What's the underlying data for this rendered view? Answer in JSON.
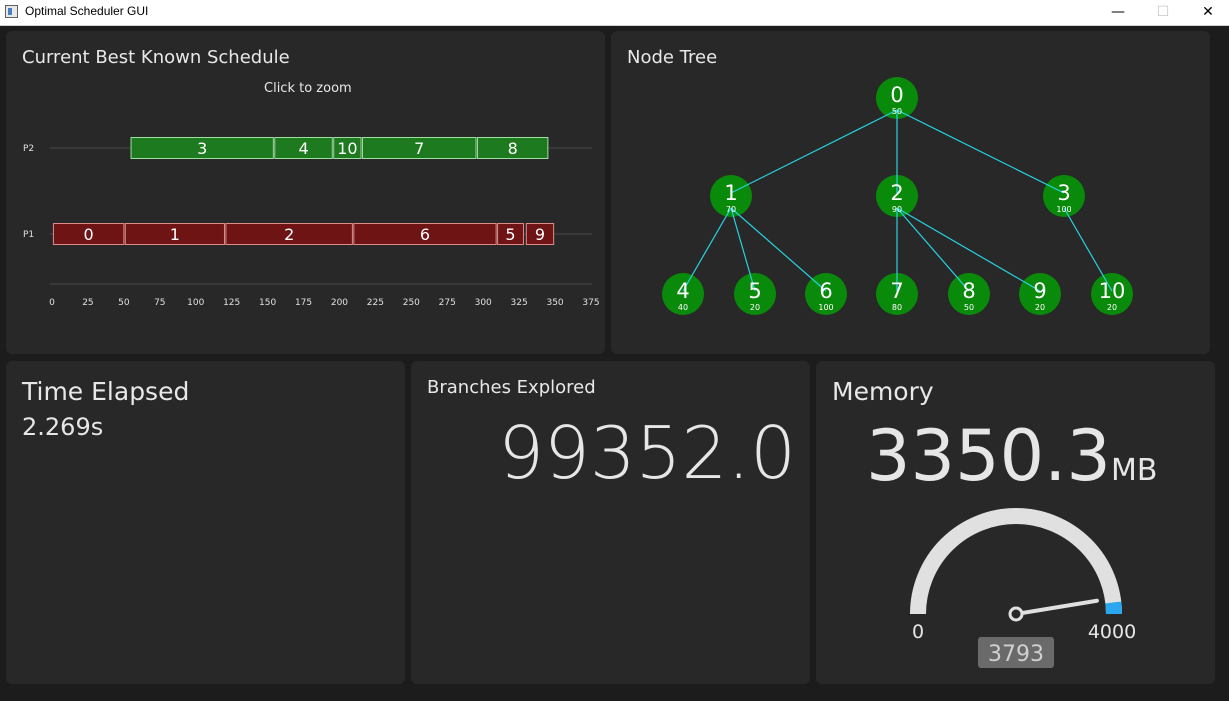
{
  "window": {
    "title": "Optimal Scheduler GUI",
    "minimize_glyph": "—",
    "maximize_glyph": "☐",
    "close_glyph": "✕"
  },
  "schedule": {
    "title": "Current Best Known Schedule",
    "hint": "Click to zoom",
    "colors": {
      "p2": "#1e7a1e",
      "p1": "#6e1414",
      "p2_border": "#9fe09f",
      "p1_border": "#e08a8a"
    },
    "chart_data": {
      "type": "bar",
      "categories": [
        "P2",
        "P1"
      ],
      "xlim": [
        0,
        375
      ],
      "x_ticks": [
        0,
        25,
        50,
        75,
        100,
        125,
        150,
        175,
        200,
        225,
        250,
        275,
        300,
        325,
        350,
        375
      ],
      "series": [
        {
          "processor": "P2",
          "tasks": [
            {
              "label": "3",
              "start": 55,
              "end": 154
            },
            {
              "label": "4",
              "start": 155,
              "end": 195
            },
            {
              "label": "10",
              "start": 196,
              "end": 215
            },
            {
              "label": "7",
              "start": 216,
              "end": 295
            },
            {
              "label": "8",
              "start": 296,
              "end": 345
            }
          ]
        },
        {
          "processor": "P1",
          "tasks": [
            {
              "label": "0",
              "start": 1,
              "end": 50
            },
            {
              "label": "1",
              "start": 51,
              "end": 120
            },
            {
              "label": "2",
              "start": 121,
              "end": 209
            },
            {
              "label": "6",
              "start": 210,
              "end": 309
            },
            {
              "label": "5",
              "start": 310,
              "end": 328
            },
            {
              "label": "9",
              "start": 330,
              "end": 349
            }
          ]
        }
      ]
    }
  },
  "node_tree": {
    "title": "Node Tree",
    "node_color": "#0a8a0a",
    "edge_color": "#27d3e0",
    "nodes": [
      {
        "id": "0",
        "weight": "50"
      },
      {
        "id": "1",
        "weight": "70"
      },
      {
        "id": "2",
        "weight": "90"
      },
      {
        "id": "3",
        "weight": "100"
      },
      {
        "id": "4",
        "weight": "40"
      },
      {
        "id": "5",
        "weight": "20"
      },
      {
        "id": "6",
        "weight": "100"
      },
      {
        "id": "7",
        "weight": "80"
      },
      {
        "id": "8",
        "weight": "50"
      },
      {
        "id": "9",
        "weight": "20"
      },
      {
        "id": "10",
        "weight": "20"
      }
    ],
    "edges": [
      [
        "0",
        "1"
      ],
      [
        "0",
        "2"
      ],
      [
        "0",
        "3"
      ],
      [
        "1",
        "4"
      ],
      [
        "1",
        "5"
      ],
      [
        "1",
        "6"
      ],
      [
        "2",
        "7"
      ],
      [
        "2",
        "8"
      ],
      [
        "2",
        "9"
      ],
      [
        "3",
        "10"
      ]
    ]
  },
  "time": {
    "title": "Time Elapsed",
    "value": "2.269s"
  },
  "branches": {
    "title": "Branches Explored",
    "value": "99352.0"
  },
  "memory": {
    "title": "Memory",
    "value": "3350.3",
    "unit": "MB",
    "gauge": {
      "min_label": "0",
      "max_label": "4000",
      "min": 0,
      "max": 4000,
      "readout": "3793",
      "level": 3793,
      "colors": {
        "track": "#e0e0e0",
        "section": "#2aa7ee",
        "needle": "#e0e0e0",
        "readout_bg": "#6a6a6a"
      }
    }
  }
}
